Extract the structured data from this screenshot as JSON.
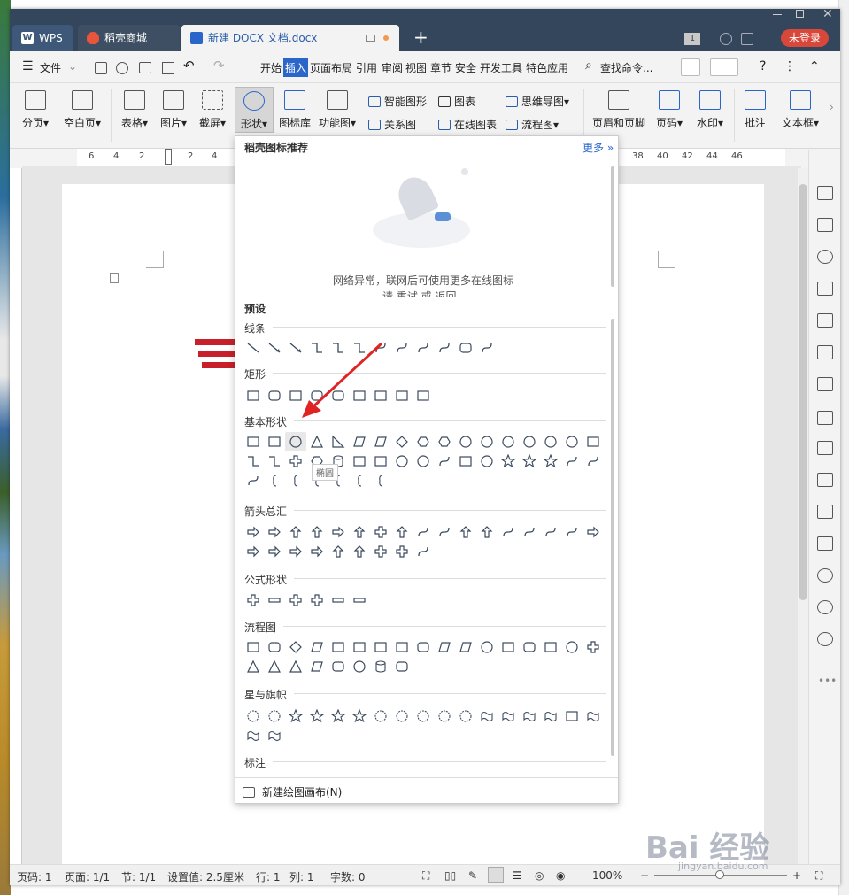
{
  "tabs": {
    "wps": "WPS",
    "daoke": "稻壳商城",
    "doc": "新建 DOCX 文档.docx",
    "login": "未登录",
    "badge": "1"
  },
  "menu": {
    "file": "文件",
    "items": [
      "开始",
      "插入",
      "页面布局",
      "引用",
      "审阅",
      "视图",
      "章节",
      "安全",
      "开发工具",
      "特色应用"
    ],
    "active": "插入",
    "search": "查找命令..."
  },
  "ribbon": {
    "pagebreak": "分页",
    "blankpage": "空白页",
    "table": "表格",
    "picture": "图片",
    "screenshot": "截屏",
    "shape": "形状",
    "iconlib": "图标库",
    "funcchart": "功能图",
    "smartart": "智能图形",
    "chart": "图表",
    "mindmap": "思维导图",
    "relation": "关系图",
    "onlinechart": "在线图表",
    "flowchart": "流程图",
    "headerfooter": "页眉和页脚",
    "pagenum": "页码",
    "watermark": "水印",
    "comment": "批注",
    "textbox": "文本框"
  },
  "ruler": [
    "6",
    "4",
    "2",
    "",
    "2",
    "4",
    "38",
    "40",
    "42",
    "44",
    "46"
  ],
  "panel": {
    "title": "稻壳图标推荐",
    "more": "更多",
    "network_msg": "网络异常，联网后可使用更多在线图标",
    "network_msg2": "请 重试 或 返回",
    "preset": "预设",
    "sections": [
      "线条",
      "矩形",
      "基本形状",
      "箭头总汇",
      "公式形状",
      "流程图",
      "星与旗帜",
      "标注"
    ],
    "tooltip": "椭圆",
    "new_canvas": "新建绘图画布(N)"
  },
  "status": {
    "page": "页码: 1",
    "pages": "页面: 1/1",
    "section": "节: 1/1",
    "setting": "设置值: 2.5厘米",
    "row": "行: 1",
    "col": "列: 1",
    "words": "字数: 0",
    "zoom": "100%"
  },
  "watermark": {
    "brand": "Bai 经验",
    "url": "jingyan.baidu.com"
  }
}
